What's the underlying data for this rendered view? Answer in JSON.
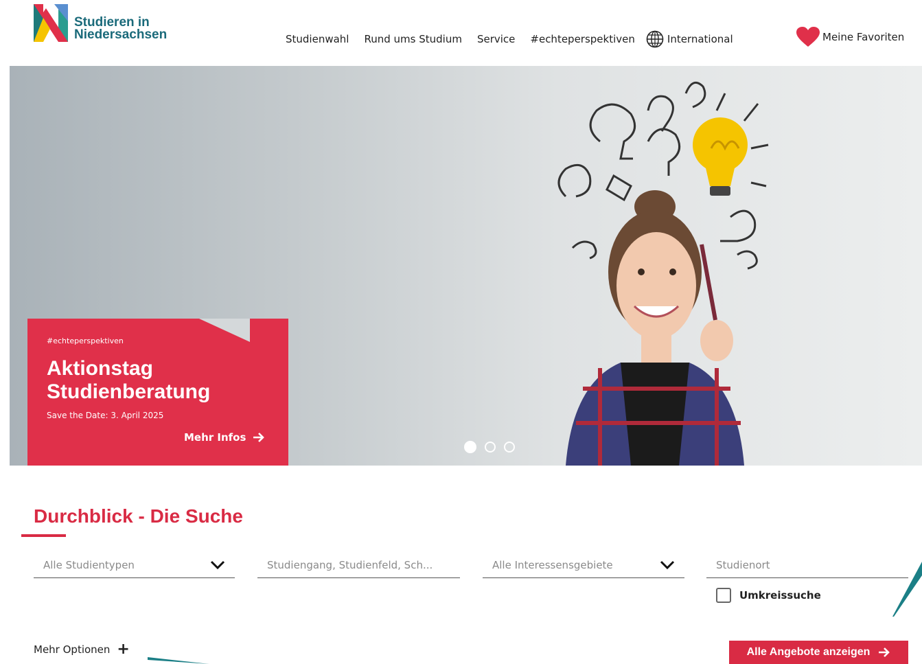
{
  "brand": {
    "line1": "Studieren in",
    "line2": "Niedersachsen"
  },
  "nav": {
    "items": [
      "Studienwahl",
      "Rund ums Studium",
      "Service",
      "#echteperspektiven",
      "International"
    ],
    "favorites": "Meine Favoriten"
  },
  "hero": {
    "tag": "#echteperspektiven",
    "title_line1": "Aktionstag",
    "title_line2": "Studienberatung",
    "subtitle": "Save the Date: 3. April 2025",
    "more_label": "Mehr Infos",
    "slides": 3,
    "active_slide": 1
  },
  "search": {
    "title": "Durchblick - Die Suche",
    "study_type_placeholder": "Alle Studientypen",
    "program_placeholder": "Studiengang, Studienfeld, Sch...",
    "interest_placeholder": "Alle Interessensgebiete",
    "location_placeholder": "Studienort",
    "radius_label": "Umkreissuche",
    "more_options": "Mehr Optionen",
    "submit_label": "Alle Angebote anzeigen"
  },
  "colors": {
    "accent": "#d92b44",
    "brand_teal": "#1a6a7a",
    "bulb": "#f5c400"
  }
}
